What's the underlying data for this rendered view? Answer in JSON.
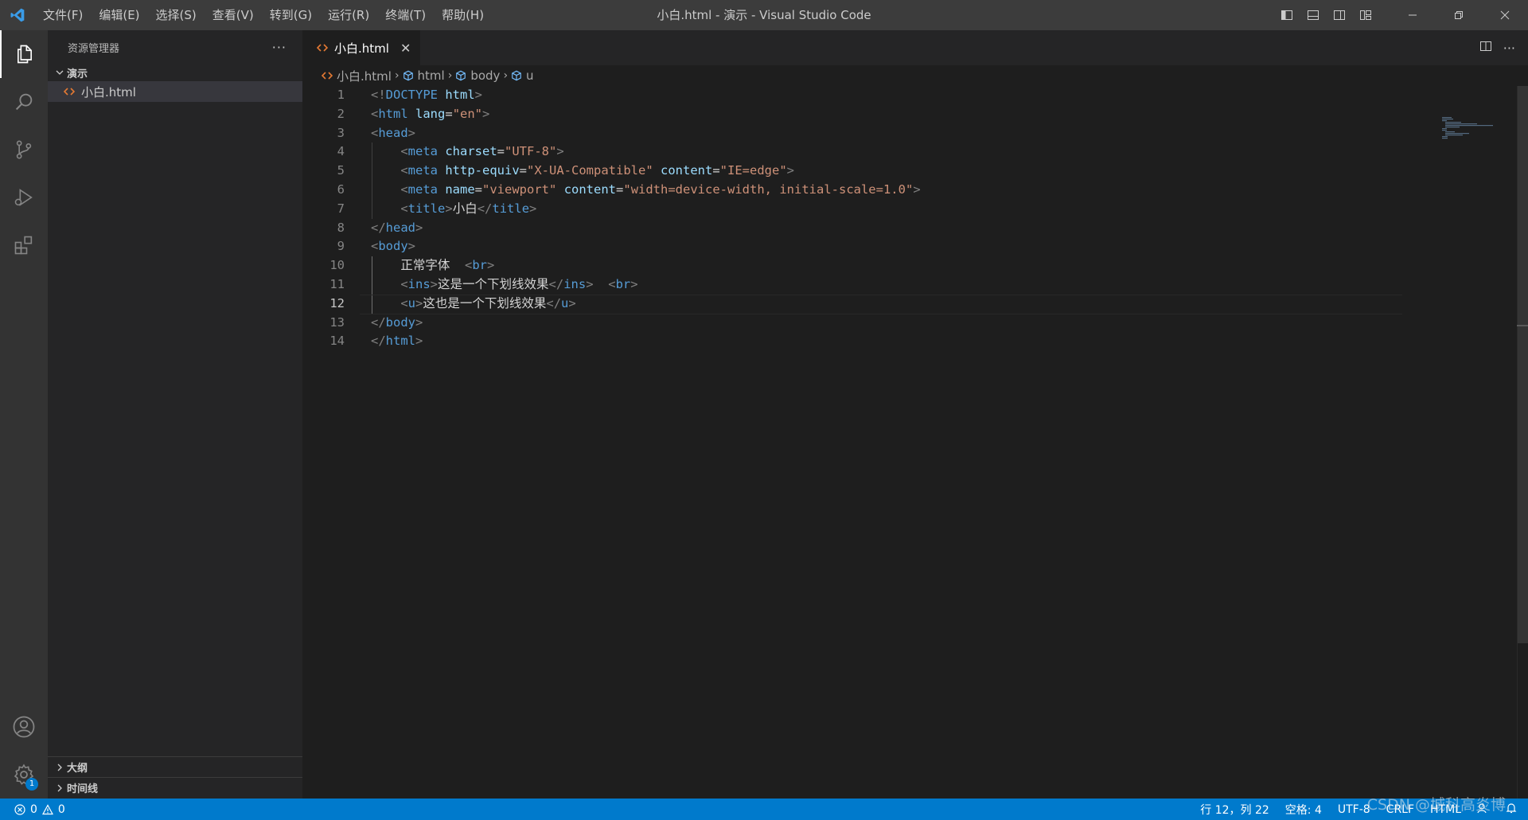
{
  "window": {
    "title": "小白.html - 演示 - Visual Studio Code"
  },
  "menu": [
    "文件(F)",
    "编辑(E)",
    "选择(S)",
    "查看(V)",
    "转到(G)",
    "运行(R)",
    "终端(T)",
    "帮助(H)"
  ],
  "sidebar": {
    "title": "资源管理器",
    "more": "···",
    "folder": "演示",
    "file": "小白.html",
    "outline": "大纲",
    "timeline": "时间线"
  },
  "editor": {
    "tab_label": "小白.html",
    "tab_close": "✕",
    "breadcrumb": [
      "小白.html",
      "html",
      "body",
      "u"
    ],
    "lines": [
      {
        "n": "1",
        "html": "<span class='t-br'>&lt;!</span><span class='t-tag'>DOCTYPE</span> <span class='t-attr'>html</span><span class='t-br'>&gt;</span>"
      },
      {
        "n": "2",
        "html": "<span class='t-br'>&lt;</span><span class='t-tag'>html</span> <span class='t-attr'>lang</span><span class='t-txt'>=</span><span class='t-str'>\"en\"</span><span class='t-br'>&gt;</span>"
      },
      {
        "n": "3",
        "html": "<span class='t-br'>&lt;</span><span class='t-tag'>head</span><span class='t-br'>&gt;</span>"
      },
      {
        "n": "4",
        "html": "    <span class='t-br'>&lt;</span><span class='t-tag'>meta</span> <span class='t-attr'>charset</span><span class='t-txt'>=</span><span class='t-str'>\"UTF-8\"</span><span class='t-br'>&gt;</span>"
      },
      {
        "n": "5",
        "html": "    <span class='t-br'>&lt;</span><span class='t-tag'>meta</span> <span class='t-attr'>http-equiv</span><span class='t-txt'>=</span><span class='t-str'>\"X-UA-Compatible\"</span> <span class='t-attr'>content</span><span class='t-txt'>=</span><span class='t-str'>\"IE=edge\"</span><span class='t-br'>&gt;</span>"
      },
      {
        "n": "6",
        "html": "    <span class='t-br'>&lt;</span><span class='t-tag'>meta</span> <span class='t-attr'>name</span><span class='t-txt'>=</span><span class='t-str'>\"viewport\"</span> <span class='t-attr'>content</span><span class='t-txt'>=</span><span class='t-str'>\"width=device-width, initial-scale=1.0\"</span><span class='t-br'>&gt;</span>"
      },
      {
        "n": "7",
        "html": "    <span class='t-br'>&lt;</span><span class='t-tag'>title</span><span class='t-br'>&gt;</span><span class='t-txt'>小白</span><span class='t-br'>&lt;/</span><span class='t-tag'>title</span><span class='t-br'>&gt;</span>"
      },
      {
        "n": "8",
        "html": "<span class='t-br'>&lt;/</span><span class='t-tag'>head</span><span class='t-br'>&gt;</span>"
      },
      {
        "n": "9",
        "html": "<span class='t-br'>&lt;</span><span class='t-tag'>body</span><span class='t-br'>&gt;</span>"
      },
      {
        "n": "10",
        "html": "    <span class='t-txt'>正常字体  </span><span class='t-br'>&lt;</span><span class='t-tag'>br</span><span class='t-br'>&gt;</span>"
      },
      {
        "n": "11",
        "html": "    <span class='t-br'>&lt;</span><span class='t-tag'>ins</span><span class='t-br'>&gt;</span><span class='t-txt'>这是一个下划线效果</span><span class='t-br'>&lt;/</span><span class='t-tag'>ins</span><span class='t-br'>&gt;</span>  <span class='t-br'>&lt;</span><span class='t-tag'>br</span><span class='t-br'>&gt;</span>"
      },
      {
        "n": "12",
        "html": "    <span class='t-br'>&lt;</span><span class='t-tag'>u</span><span class='t-br'>&gt;</span><span class='t-txt'>这也是一个下划线效果</span><span class='t-br'>&lt;/</span><span class='t-tag'>u</span><span class='t-br'>&gt;</span>"
      },
      {
        "n": "13",
        "html": "<span class='t-br'>&lt;/</span><span class='t-tag'>body</span><span class='t-br'>&gt;</span>"
      },
      {
        "n": "14",
        "html": "<span class='t-br'>&lt;/</span><span class='t-tag'>html</span><span class='t-br'>&gt;</span>"
      }
    ],
    "current_line": "12"
  },
  "statusbar": {
    "errors": "0",
    "warnings": "0",
    "position": "行 12，列 22",
    "spaces": "空格: 4",
    "encoding": "UTF-8",
    "eol": "CRLF",
    "language": "HTML"
  },
  "watermark": "CSDN @城科高炎博",
  "colors": {
    "accent": "#007acc",
    "titlebar": "#3c3c3c",
    "activitybar": "#333333",
    "sidebar": "#252526",
    "editor": "#1e1e1e",
    "html_file_icon": "#e37933"
  },
  "icons": {
    "app": "vscode-logo-icon",
    "activity": [
      "explorer-icon",
      "search-icon",
      "source-control-icon",
      "run-debug-icon",
      "extensions-icon",
      "account-icon",
      "settings-gear-icon"
    ]
  }
}
